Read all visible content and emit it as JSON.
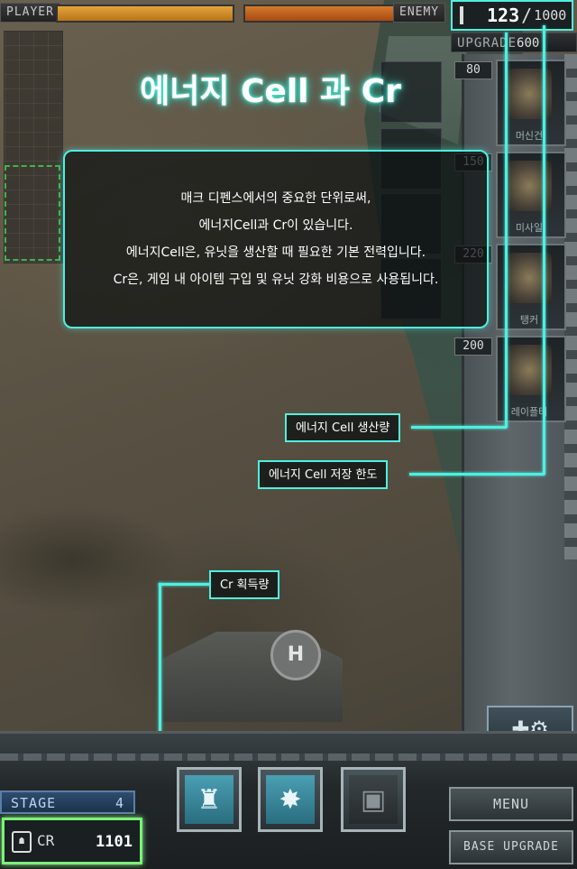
{
  "hud": {
    "player_label": "PLAYER",
    "enemy_label": "ENEMY",
    "player_health": 1.0,
    "enemy_health": 1.0,
    "energy_current": "123",
    "energy_separator": "/",
    "energy_max": "1000",
    "upgrade_label": "UPGRADE",
    "upgrade_cost": "600 cell"
  },
  "units": [
    {
      "cost": "80",
      "name": "머신건"
    },
    {
      "cost": "150",
      "name": "미사일"
    },
    {
      "cost": "220",
      "name": "탱커"
    },
    {
      "cost": "200",
      "name": "레이플터"
    }
  ],
  "tutorial": {
    "title": "에너지 Cell 과 Cr",
    "lines": [
      "매크 디펜스에서의 중요한 단위로써,",
      "에너지Cell과 Cr이 있습니다.",
      "에너지Cell은, 유닛을 생산할 때 필요한 기본 전력입니다.",
      "Cr은, 게임 내 아이템 구입 및 유닛 강화 비용으로 사용됩니다."
    ],
    "callout_energy_production": "에너지 Cell 생산량",
    "callout_energy_limit": "에너지 Cell 저장 한도",
    "callout_cr": "Cr 획득량"
  },
  "bottom": {
    "stage_label": "STAGE",
    "stage_value": "4",
    "cr_label": "CR",
    "cr_value": "1101",
    "menu_label": "MENU",
    "base_upgrade_label": "BASE UPGRADE",
    "tools_label": "✚⚙"
  },
  "map": {
    "helipad_letter": "H"
  },
  "colors": {
    "accent": "#4df0e0",
    "cr_highlight": "#7cf07a"
  }
}
